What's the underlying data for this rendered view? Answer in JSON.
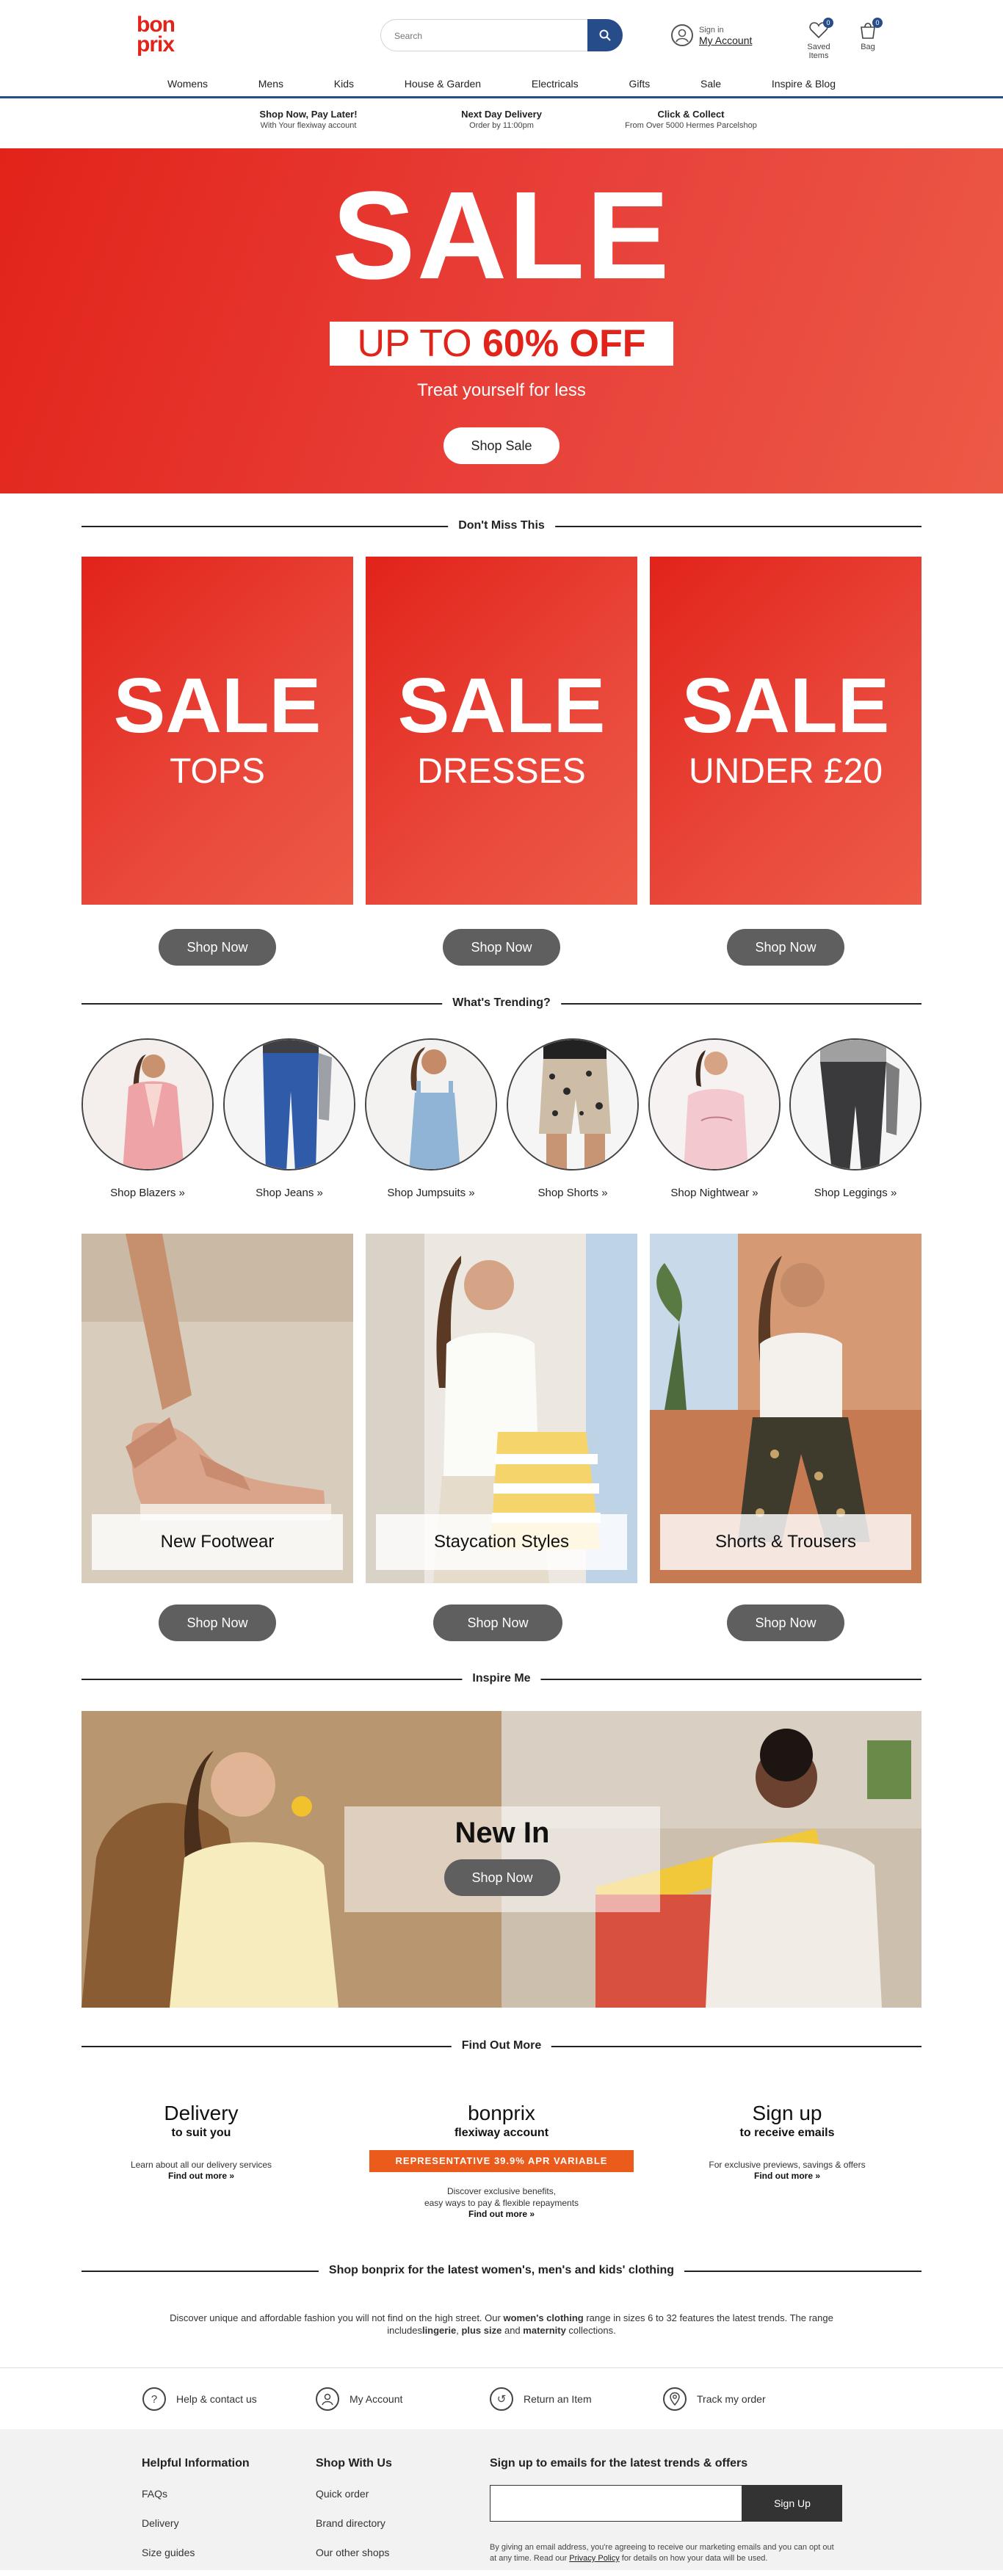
{
  "header": {
    "logo_line1": "bon",
    "logo_line2": "prix",
    "search_placeholder": "Search",
    "account_signin": "Sign in",
    "account_label": "My Account",
    "saved_label": "Saved Items",
    "saved_count": "0",
    "bag_label": "Bag",
    "bag_count": "0"
  },
  "nav": [
    "Womens",
    "Mens",
    "Kids",
    "House & Garden",
    "Electricals",
    "Gifts",
    "Sale",
    "Inspire & Blog"
  ],
  "usps": [
    {
      "title": "Shop Now, Pay Later!",
      "sub": "With Your flexiway account"
    },
    {
      "title": "Next Day Delivery",
      "sub": "Order by 11:00pm"
    },
    {
      "title": "Click & Collect",
      "sub": "From Over 5000 Hermes Parcelshop"
    }
  ],
  "hero": {
    "title": "SALE",
    "up_to": "UP TO ",
    "percent": "60% OFF",
    "tagline": "Treat yourself for less",
    "cta": "Shop Sale"
  },
  "sections": {
    "dont_miss": "Don't Miss This",
    "trending": "What's Trending?",
    "inspire": "Inspire Me",
    "find_out": "Find Out More",
    "seo_heading": "Shop bonprix for the latest women's, men's and kids' clothing"
  },
  "sale_tiles": [
    {
      "title": "SALE",
      "sub": "TOPS",
      "cta": "Shop Now"
    },
    {
      "title": "SALE",
      "sub": "DRESSES",
      "cta": "Shop Now"
    },
    {
      "title": "SALE",
      "sub": "UNDER £20",
      "cta": "Shop Now"
    }
  ],
  "trending": [
    {
      "label": "Shop Blazers »"
    },
    {
      "label": "Shop Jeans »"
    },
    {
      "label": "Shop Jumpsuits »"
    },
    {
      "label": "Shop Shorts »"
    },
    {
      "label": "Shop Nightwear »"
    },
    {
      "label": "Shop Leggings »"
    }
  ],
  "photo_tiles": [
    {
      "label": "New Footwear",
      "cta": "Shop Now"
    },
    {
      "label": "Staycation Styles",
      "cta": "Shop Now"
    },
    {
      "label": "Shorts & Trousers",
      "cta": "Shop Now"
    }
  ],
  "inspire": {
    "title": "New In",
    "cta": "Shop Now"
  },
  "find_out_more": [
    {
      "title": "Delivery",
      "sub": "to suit you",
      "text": "Learn about all our delivery services",
      "link": "Find out more »"
    },
    {
      "title": "bonprix",
      "sub": "flexiway account",
      "badge": "REPRESENTATIVE 39.9% APR VARIABLE",
      "text1": "Discover exclusive benefits,",
      "text2": "easy ways to pay & flexible repayments",
      "link": "Find out more »"
    },
    {
      "title": "Sign up",
      "sub": "to receive emails",
      "text": "For exclusive previews, savings & offers",
      "link": "Find out more »"
    }
  ],
  "seo": {
    "p1": "Discover unique and affordable fashion you will not find on the high street. Our ",
    "b1": "women's clothing",
    "p2": " range in sizes 6 to 32 features the latest trends. The range includes",
    "b2": "lingerie",
    "p3": ", ",
    "b3": "plus size",
    "p4": " and ",
    "b4": "maternity",
    "p5": " collections."
  },
  "help_links": [
    "Help & contact us",
    "My Account",
    "Return an Item",
    "Track my order"
  ],
  "footer": {
    "col1_title": "Helpful Information",
    "col1_items": [
      "FAQs",
      "Delivery",
      "Size guides"
    ],
    "col2_title": "Shop With Us",
    "col2_items": [
      "Quick order",
      "Brand directory",
      "Our other shops"
    ],
    "signup_title": "Sign up to emails for the latest trends & offers",
    "signup_btn": "Sign Up",
    "legal1": "By giving an email address, you're agreeing to receive our marketing emails and you can opt out at any time. Read our ",
    "legal_link": "Privacy Policy",
    "legal2": " for details on how your data will be used."
  },
  "colors": {
    "brand_red": "#e2231a",
    "brand_blue": "#274c8a",
    "cta_grey": "#5f5f5f",
    "apr_orange": "#ea5b1c"
  }
}
